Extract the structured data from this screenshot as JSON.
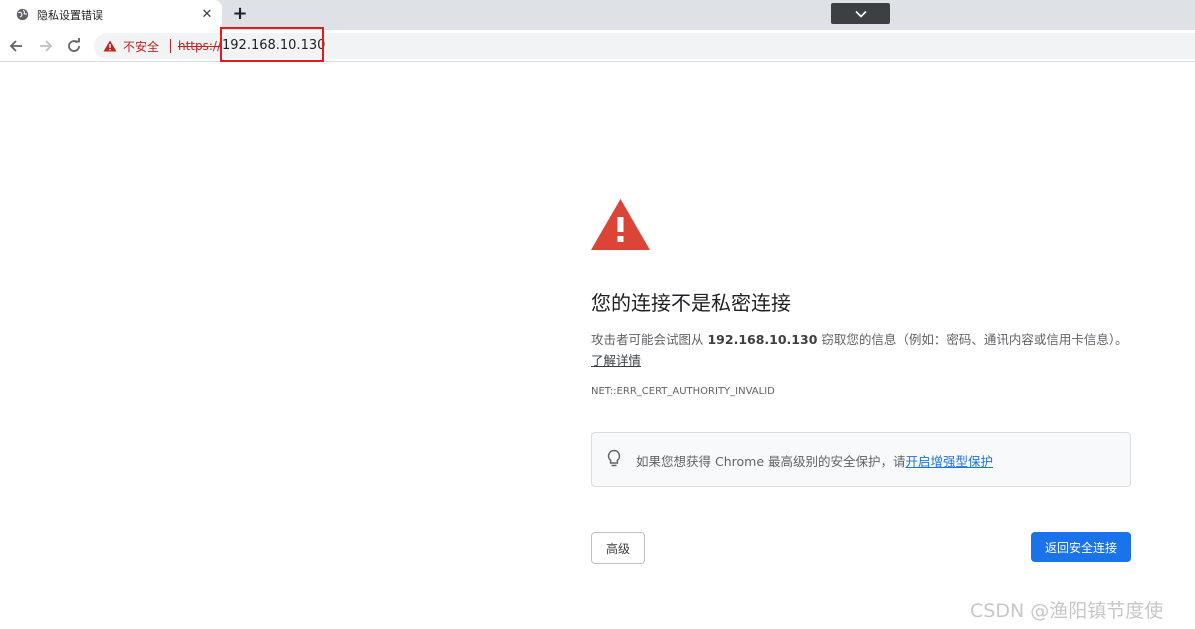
{
  "tab": {
    "title": "隐私设置错误",
    "close_glyph": "✕",
    "new_tab_glyph": "+",
    "favicon": "globe-icon"
  },
  "toolbar": {
    "back_icon": "arrow-left-icon",
    "forward_icon": "arrow-right-icon",
    "reload_icon": "reload-icon",
    "security_label": "不安全",
    "url_scheme": "https://",
    "url_host": "192.168.10.130",
    "tab_search_icon": "chevron-down-icon"
  },
  "interstitial": {
    "heading": "您的连接不是私密连接",
    "explanation_before": "攻击者可能会试图从 ",
    "explanation_host": "192.168.10.130",
    "explanation_after": " 窃取您的信息（例如：密码、通讯内容或信用卡信息）。",
    "learn_more": "了解详情",
    "error_code": "NET::ERR_CERT_AUTHORITY_INVALID",
    "enhanced_text": "如果您想获得 Chrome 最高级别的安全保护，请",
    "enhanced_link": "开启增强型保护",
    "advanced_button": "高级",
    "back_button": "返回安全连接"
  },
  "colors": {
    "danger": "#d93025",
    "link": "#1a73e8",
    "primary_button": "#1a73e8",
    "highlight_box": "#e31b1b"
  },
  "watermark": "CSDN @渔阳镇节度使"
}
